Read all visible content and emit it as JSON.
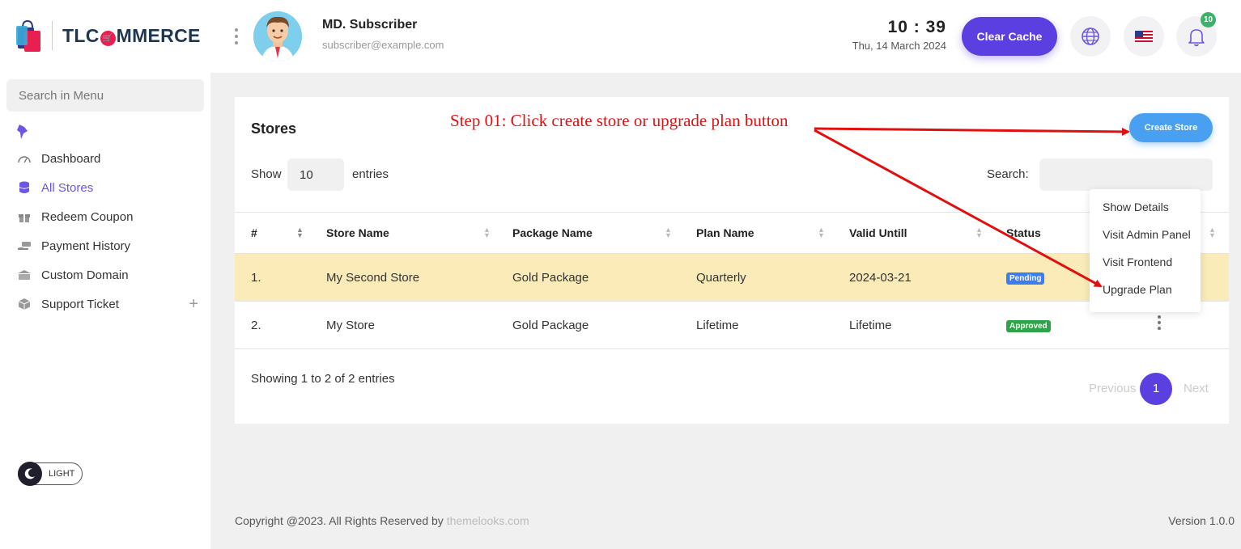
{
  "brand": {
    "logo_text_pre": "TLC",
    "logo_text_post": "MMERCE",
    "logo_o_glyph": "🛒"
  },
  "user": {
    "name": "MD. Subscriber",
    "email": "subscriber@example.com"
  },
  "clock": {
    "time": "10 : 39",
    "date": "Thu, 14 March 2024"
  },
  "header": {
    "clear_cache_label": "Clear Cache",
    "notification_count": "10"
  },
  "sidebar": {
    "search_placeholder": "Search in Menu",
    "items": [
      {
        "label": "Dashboard",
        "icon": "gauge-icon",
        "active": false
      },
      {
        "label": "All Stores",
        "icon": "database-icon",
        "active": true
      },
      {
        "label": "Redeem Coupon",
        "icon": "gift-icon",
        "active": false
      },
      {
        "label": "Payment History",
        "icon": "money-hand-icon",
        "active": false
      },
      {
        "label": "Custom Domain",
        "icon": "bank-icon",
        "active": false
      },
      {
        "label": "Support Ticket",
        "icon": "cube-icon",
        "active": false
      }
    ],
    "theme_label": "LIGHT"
  },
  "stores": {
    "title": "Stores",
    "create_label": "Create Store",
    "show_label": "Show",
    "entries_value": "10",
    "entries_label": "entries",
    "search_label": "Search:",
    "columns": [
      "#",
      "Store Name",
      "Package Name",
      "Plan Name",
      "Valid Untill",
      "Status"
    ],
    "rows": [
      {
        "num": "1.",
        "store": "My Second Store",
        "package": "Gold Package",
        "plan": "Quarterly",
        "valid": "2024-03-21",
        "status": "Pending"
      },
      {
        "num": "2.",
        "store": "My Store",
        "package": "Gold Package",
        "plan": "Lifetime",
        "valid": "Lifetime",
        "status": "Approved"
      }
    ],
    "dropdown": [
      "Show Details",
      "Visit Admin Panel",
      "Visit Frontend",
      "Upgrade Plan"
    ],
    "showing": "Showing 1 to 2 of 2 entries",
    "pagination": {
      "prev": "Previous",
      "current": "1",
      "next": "Next"
    }
  },
  "annotation": "Step 01: Click create store or upgrade plan button",
  "footer": {
    "copyright": "Copyright @2023. All Rights Reserved by ",
    "link": "themelooks.com",
    "version": "Version 1.0.0"
  },
  "colors": {
    "primary": "#5b3fe0",
    "accent_blue": "#4aa0f0",
    "highlight_row": "#faebb8",
    "annotation_red": "#e01010"
  }
}
